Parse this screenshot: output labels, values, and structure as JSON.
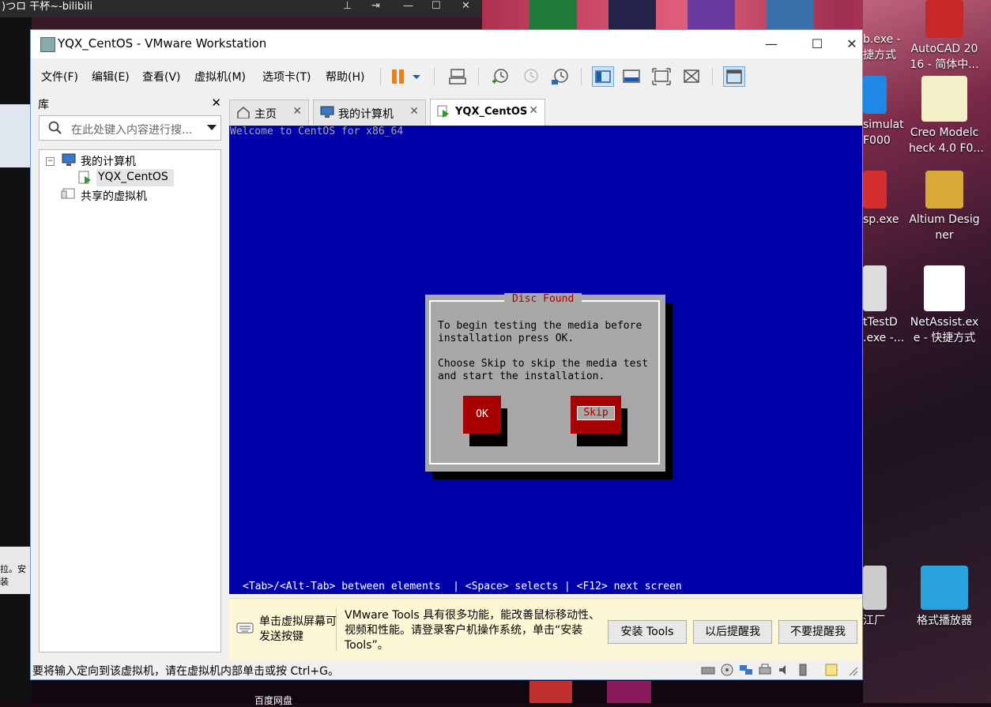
{
  "background_window": {
    "title": ")つロ 干杯~-bilibili",
    "left_notice_fragment": "拉。安装"
  },
  "desktop": {
    "icons": [
      {
        "label": "b.exe -\n捷方式",
        "name": "partial-exe-shortcut"
      },
      {
        "label": "AutoCAD 20\n16 - 简体中...",
        "name": "autocad-shortcut"
      },
      {
        "label": "simulat\nF000",
        "name": "simulat-shortcut"
      },
      {
        "label": "Creo Modelc\nheck 4.0 F0...",
        "name": "creo-shortcut"
      },
      {
        "label": "sp.exe",
        "name": "sp-exe-shortcut"
      },
      {
        "label": "Altium Desig\nner",
        "name": "altium-shortcut"
      },
      {
        "label": "tTestD\n.exe -...",
        "name": "testd-shortcut"
      },
      {
        "label": "NetAssist.ex\ne - 快捷方式",
        "name": "netassist-shortcut"
      },
      {
        "label": "江厂",
        "name": "factory-shortcut"
      },
      {
        "label": "格式播放器",
        "name": "format-player-shortcut"
      }
    ],
    "taskbar_partial": "百度网盘"
  },
  "window": {
    "title": "YQX_CentOS - VMware Workstation",
    "controls": {
      "minimize": "—",
      "maximize": "☐",
      "close": "✕"
    }
  },
  "menu": {
    "file": "文件(F)",
    "edit": "编辑(E)",
    "view": "查看(V)",
    "vm": "虚拟机(M)",
    "tabs": "选项卡(T)",
    "help": "帮助(H)"
  },
  "library": {
    "title": "库",
    "close": "✕",
    "search_placeholder": "在此处键入内容进行搜...",
    "tree": {
      "my_computer": "我的计算机",
      "vm": "YQX_CentOS",
      "shared": "共享的虚拟机"
    }
  },
  "tabs": [
    {
      "label": "主页",
      "close": "✕"
    },
    {
      "label": "我的计算机",
      "close": "✕"
    },
    {
      "label": "YQX_CentOS",
      "close": "✕"
    }
  ],
  "console": {
    "welcome": "Welcome to CentOS for x86_64",
    "dialog": {
      "title": "Disc Found",
      "line1": "To begin testing the media before",
      "line2": "installation press OK.",
      "line3": "Choose Skip to skip the media test",
      "line4": "and start the installation.",
      "ok": "OK",
      "skip": "Skip"
    },
    "help_line": "<Tab>/<Alt-Tab> between elements  | <Space> selects | <F12> next screen"
  },
  "notice": {
    "hint": "单击虚拟屏幕可发送按键",
    "message": "VMware Tools 具有很多功能，能改善鼠标移动性、视频和性能。请登录客户机操作系统，单击“安装 Tools”。",
    "install": "安装 Tools",
    "remind_later": "以后提醒我",
    "never_remind": "不要提醒我"
  },
  "status": {
    "text": "要将输入定向到该虚拟机，请在虚拟机内部单击或按 Ctrl+G。"
  },
  "colors": {
    "console_bg": "#0000a8",
    "dialog_bg": "#a8a8a8",
    "button_red": "#a80000",
    "notice_bg": "#fdf7d6"
  }
}
